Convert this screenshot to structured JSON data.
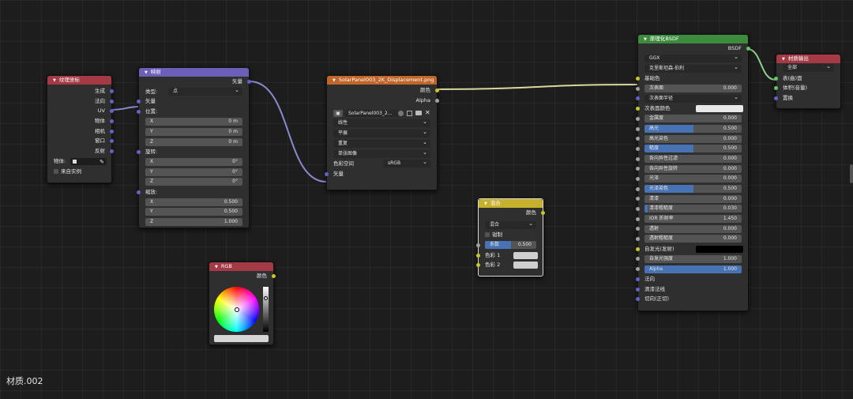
{
  "material_name": "材质.002",
  "texcoord": {
    "title": "纹理坐标",
    "outputs": [
      "生成",
      "法向",
      "UV",
      "物体",
      "相机",
      "窗口",
      "反射"
    ],
    "object_label": "物体:",
    "from_instancer": "来自实例"
  },
  "mapping": {
    "title": "映射",
    "output": "矢量",
    "type_label": "类型:",
    "type_value": "点",
    "vector_in": "矢量",
    "location_label": "位置:",
    "location": [
      {
        "k": "X",
        "v": "0 m"
      },
      {
        "k": "Y",
        "v": "0 m"
      },
      {
        "k": "Z",
        "v": "0 m"
      }
    ],
    "rotation_label": "旋转:",
    "rotation": [
      {
        "k": "X",
        "v": "0°"
      },
      {
        "k": "Y",
        "v": "0°"
      },
      {
        "k": "Z",
        "v": "0°"
      }
    ],
    "scale_label": "缩放:",
    "scale": [
      {
        "k": "X",
        "v": "0.500"
      },
      {
        "k": "Y",
        "v": "0.500"
      },
      {
        "k": "Z",
        "v": "1.000"
      }
    ]
  },
  "image": {
    "title": "SolarPanel003_2K_Displacement.png",
    "out_color": "颜色",
    "out_alpha": "Alpha",
    "image_name": "SolarPanel003_2...",
    "interpolation": "线性",
    "projection": "平展",
    "extension": "重复",
    "source": "单张图像",
    "colorspace_label": "色彩空间",
    "colorspace_value": "sRGB",
    "vector_in": "矢量"
  },
  "rgb": {
    "title": "RGB",
    "output": "颜色"
  },
  "mix": {
    "title": "混合",
    "output": "颜色",
    "blend_mode": "混合",
    "clamp": "钳制",
    "factor_label": "系数",
    "factor_value": "0.500",
    "factor": 0.5,
    "color1": "色彩 1",
    "color2": "色彩 2"
  },
  "bsdf": {
    "title": "原理化BSDF",
    "output": "BSDF",
    "distribution": "GGX",
    "subsurface_method": "克里斯坦森-伯利",
    "base_color": "基础色",
    "subsurface": {
      "k": "次表面",
      "v": "0.000",
      "f": 0
    },
    "subsurface_radius": "次表面半径",
    "subsurface_color": "次表面颜色",
    "params": [
      {
        "k": "金属度",
        "v": "0.000",
        "f": 0
      },
      {
        "k": "高光",
        "v": "0.500",
        "f": 0.5
      },
      {
        "k": "高光染色",
        "v": "0.000",
        "f": 0
      },
      {
        "k": "糙度",
        "v": "0.500",
        "f": 0.5
      },
      {
        "k": "各向异性过滤",
        "v": "0.000",
        "f": 0
      },
      {
        "k": "各向异性旋转",
        "v": "0.000",
        "f": 0
      },
      {
        "k": "光泽",
        "v": "0.000",
        "f": 0
      },
      {
        "k": "光泽染色",
        "v": "0.500",
        "f": 0.5
      },
      {
        "k": "清漆",
        "v": "0.000",
        "f": 0
      },
      {
        "k": "清漆粗糙度",
        "v": "0.030",
        "f": 0.03
      },
      {
        "k": "IOR 折射率",
        "v": "1.450",
        "f": 0
      },
      {
        "k": "透射",
        "v": "0.000",
        "f": 0
      },
      {
        "k": "透射粗糙度",
        "v": "0.000",
        "f": 0
      }
    ],
    "emission": "自发光(发射)",
    "emission_strength": {
      "k": "自发光强度",
      "v": "1.000"
    },
    "alpha": {
      "k": "Alpha",
      "v": "1.000",
      "f": 1
    },
    "normal": "法向",
    "clearcoat_normal": "清漆法线",
    "tangent": "切向(正切)"
  },
  "output": {
    "title": "材质输出",
    "target": "全部",
    "inputs": [
      "表(曲)面",
      "体积(音量)",
      "置换"
    ]
  },
  "colors": {
    "input_header": "#a33a45",
    "vector_header": "#6b5fb8",
    "texture_header": "#c0662a",
    "color_header": "#c7b02b",
    "shader_header": "#3d8c3d",
    "output_header": "#a33a45",
    "value_bar": "#4772b3"
  }
}
